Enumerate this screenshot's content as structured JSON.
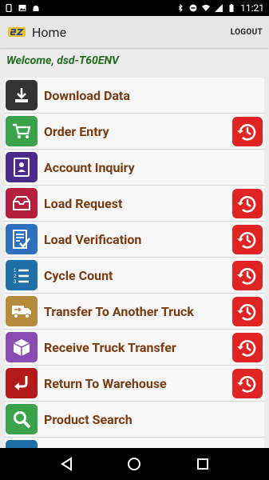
{
  "status_bar": {
    "time": "11:21",
    "left_icons": [
      "device-icon",
      "image-icon",
      "android-icon"
    ],
    "right_icons": [
      "bluetooth-icon",
      "do-not-disturb-icon",
      "wifi-icon",
      "signal-icon",
      "battery-icon"
    ]
  },
  "app_bar": {
    "title": "Home",
    "logout_label": "LOGOUT"
  },
  "welcome_text": "Welcome, dsd-T60ENV",
  "menu": {
    "items": [
      {
        "label": "Download Data",
        "icon": "download-icon",
        "color": "#333333",
        "has_history": false
      },
      {
        "label": "Order Entry",
        "icon": "cart-icon",
        "color": "#3aa34a",
        "has_history": true
      },
      {
        "label": "Account Inquiry",
        "icon": "account-card-icon",
        "color": "#4a2a8c",
        "has_history": false
      },
      {
        "label": "Load Request",
        "icon": "inbox-tray-icon",
        "color": "#b5213d",
        "has_history": true
      },
      {
        "label": "Load Verification",
        "icon": "checklist-icon",
        "color": "#2e6fbf",
        "has_history": true
      },
      {
        "label": "Cycle Count",
        "icon": "numbered-list-icon",
        "color": "#1f6fa8",
        "has_history": true
      },
      {
        "label": "Transfer To Another Truck",
        "icon": "truck-transfer-icon",
        "color": "#b88a3c",
        "has_history": true
      },
      {
        "label": "Receive Truck Transfer",
        "icon": "box-receive-icon",
        "color": "#8a4bb5",
        "has_history": true
      },
      {
        "label": "Return To Warehouse",
        "icon": "return-arrow-icon",
        "color": "#b31a1a",
        "has_history": true
      },
      {
        "label": "Product Search",
        "icon": "magnifier-icon",
        "color": "#3aa34a",
        "has_history": false
      }
    ],
    "history_color": "#e02424"
  },
  "nav_bar": {
    "buttons": [
      "back-icon",
      "home-icon",
      "recents-icon"
    ]
  }
}
